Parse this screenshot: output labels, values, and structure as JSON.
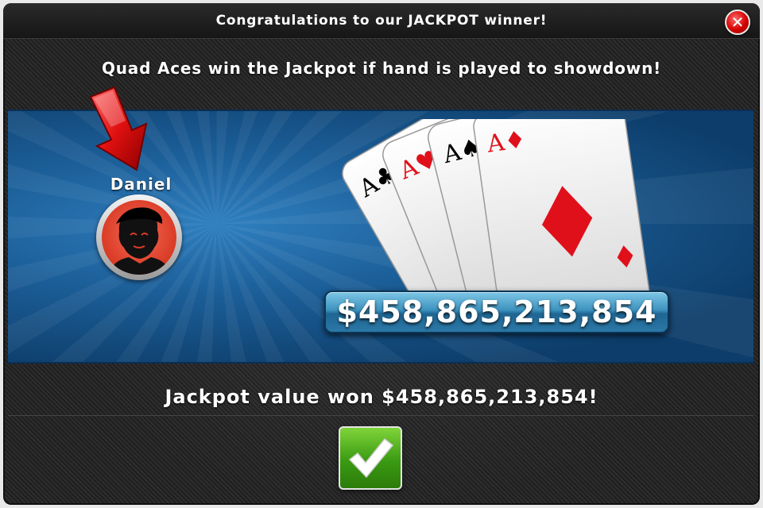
{
  "dialog": {
    "title": "Congratulations to our JACKPOT winner!",
    "close_icon": "close-icon",
    "subtitle": "Quad Aces win the Jackpot if hand is played to showdown!"
  },
  "winner": {
    "name": "Daniel",
    "arrow_icon": "arrow-down-icon",
    "avatar": "player-avatar"
  },
  "hand": {
    "cards": [
      "A♣",
      "A♥",
      "A♠",
      "A♦"
    ]
  },
  "jackpot": {
    "amount": "$458,865,213,854",
    "won_message": "Jackpot value won $458,865,213,854!"
  },
  "confirm": {
    "icon": "checkmark-icon"
  },
  "colors": {
    "panel_blue": "#1c5f99",
    "close_red": "#d40000",
    "ok_green": "#3a9a12",
    "card_red": "#e0101a"
  }
}
